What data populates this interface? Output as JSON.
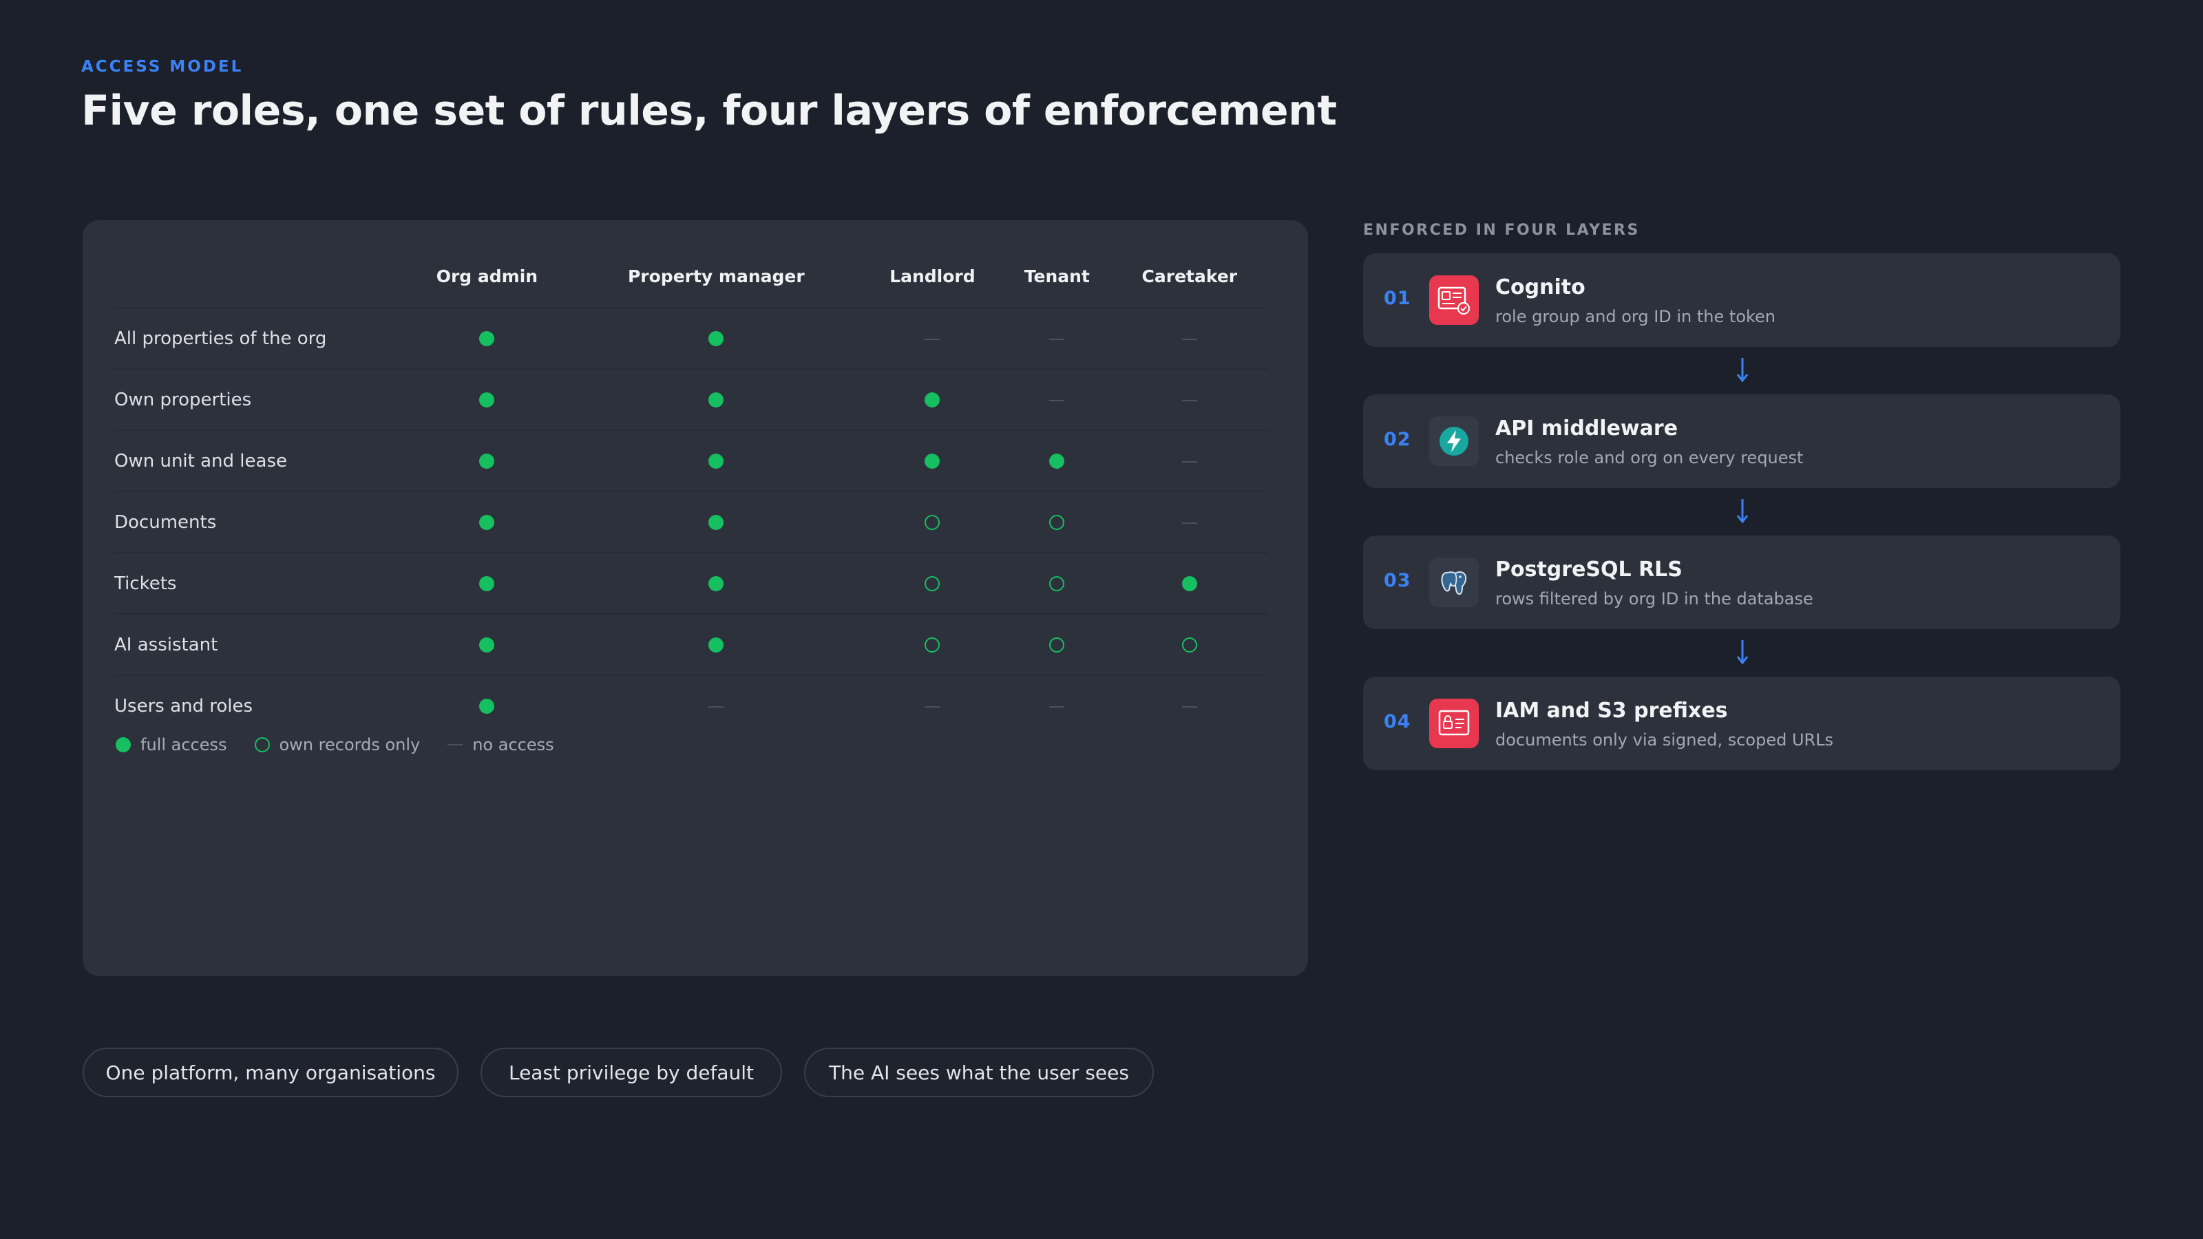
{
  "header": {
    "eyebrow": "ACCESS MODEL",
    "title": "Five roles, one set of rules, four layers of enforcement"
  },
  "matrix": {
    "roles": [
      "Org admin",
      "Property manager",
      "Landlord",
      "Tenant",
      "Caretaker"
    ],
    "rows": [
      {
        "label": "All properties of the org",
        "access": [
          "full",
          "full",
          "none",
          "none",
          "none"
        ]
      },
      {
        "label": "Own properties",
        "access": [
          "full",
          "full",
          "full",
          "none",
          "none"
        ]
      },
      {
        "label": "Own unit and lease",
        "access": [
          "full",
          "full",
          "full",
          "full",
          "none"
        ]
      },
      {
        "label": "Documents",
        "access": [
          "full",
          "full",
          "own",
          "own",
          "none"
        ]
      },
      {
        "label": "Tickets",
        "access": [
          "full",
          "full",
          "own",
          "own",
          "full"
        ]
      },
      {
        "label": "AI assistant",
        "access": [
          "full",
          "full",
          "own",
          "own",
          "own"
        ]
      },
      {
        "label": "Users and roles",
        "access": [
          "full",
          "none",
          "none",
          "none",
          "none"
        ]
      }
    ],
    "legend": {
      "full": "full access",
      "own": "own records only",
      "none": "no access"
    },
    "colors": {
      "access_dot": "#16c060",
      "none_dash": "#4a505c"
    }
  },
  "layers": {
    "label": "ENFORCED IN FOUR LAYERS",
    "items": [
      {
        "num": "01",
        "name": "Cognito",
        "desc": "role group and org ID in the token",
        "icon": "cognito-id-card-icon",
        "color": "#e8384f"
      },
      {
        "num": "02",
        "name": "API middleware",
        "desc": "checks role and org on every request",
        "icon": "lightning-bolt-icon",
        "color": "#19a7a0"
      },
      {
        "num": "03",
        "name": "PostgreSQL RLS",
        "desc": "rows filtered by org ID in the database",
        "icon": "postgresql-elephant-icon",
        "color": "#336791"
      },
      {
        "num": "04",
        "name": "IAM and S3 prefixes",
        "desc": "documents only via signed, scoped URLs",
        "icon": "iam-badge-icon",
        "color": "#e8384f"
      }
    ]
  },
  "pills": [
    "One platform, many organisations",
    "Least privilege by default",
    "The AI sees what the user sees"
  ]
}
